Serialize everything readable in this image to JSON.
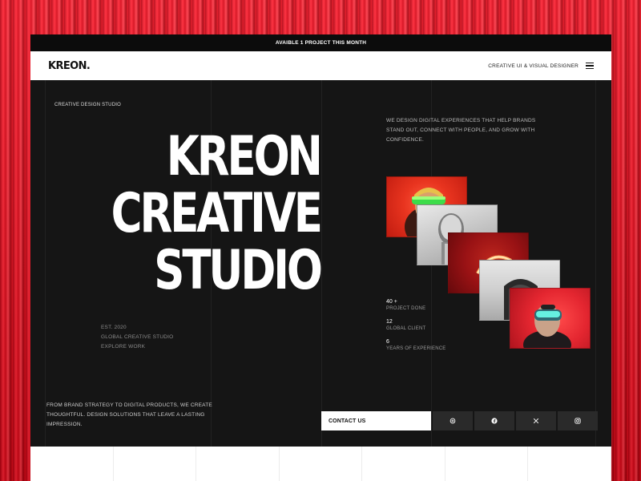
{
  "announcement": "AVAIBLE 1 PROJECT THIS MONTH",
  "nav": {
    "logo": "KREON.",
    "tagline": "CREATIVE UI & VISUAL DESIGNER",
    "menu_icon": "hamburger-menu-icon"
  },
  "hero": {
    "eyebrow": "CREATIVE DESIGN STUDIO",
    "headline": [
      "KREON",
      "CREATIVE",
      "STUDIO"
    ],
    "meta": {
      "established": "EST. 2020",
      "studio": "GLOBAL CREATIVE STUDIO",
      "explore": "EXPLORE WORK"
    },
    "intro": "FROM BRAND STRATEGY TO DIGITAL PRODUCTS, WE CREATE THOUGHTFUL. DESIGN SOLUTIONS THAT LEAVE A LASTING IMPRESSION.",
    "tagline": "WE DESIGN DIGITAL EXPERIENCES THAT HELP BRANDS STAND OUT, CONNECT WITH PEOPLE, AND GROW WITH CONFIDENCE."
  },
  "stats": [
    {
      "value": "40 +",
      "label": "PROJECT DONE"
    },
    {
      "value": "12",
      "label": "GLOBAL CLIENT"
    },
    {
      "value": "6",
      "label": "YEARS OF EXPERIENCE"
    }
  ],
  "cta": {
    "contact_label": "CONTACT US"
  },
  "social": [
    "threads-icon",
    "facebook-icon",
    "x-icon",
    "instagram-icon"
  ],
  "colors": {
    "backdrop": "#e3101e",
    "panel": "#151515",
    "accent_red": "#e8341f",
    "visor_green": "#3ddc4a"
  }
}
